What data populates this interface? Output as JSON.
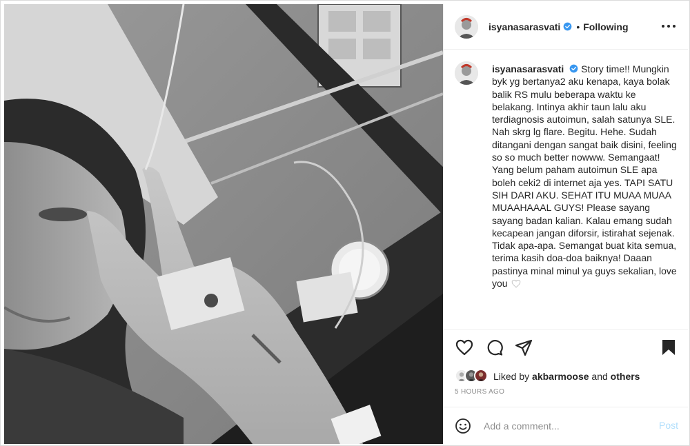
{
  "post": {
    "username": "isyanasarasvati",
    "follow_status": "Following",
    "separator": "•",
    "caption_text": "Story time!! Mungkin byk yg bertanya2 aku kenapa, kaya bolak balik RS mulu beberapa waktu ke belakang. Intinya akhir taun lalu aku terdiagnosis autoimun, salah satunya SLE. Nah skrg lg flare. Begitu. Hehe. Sudah ditangani dengan sangat baik disini, feeling so so much better nowww. Semangaat! Yang belum paham autoimun SLE apa boleh ceki2 di internet aja yes. TAPI SATU SIH DARI AKU. SEHAT ITU MUAA MUAA MUAAHAAAL GUYS! Please sayang sayang badan kalian. Kalau emang sudah kecapean jangan diforsir, istirahat sejenak. Tidak apa-apa. Semangat buat kita semua, terima kasih doa-doa baiknya! Daaan pastinya minal minul ya guys sekalian, love you",
    "likes": {
      "prefix": "Liked by",
      "user": "akbarmoose",
      "joiner": "and",
      "others": "others"
    },
    "timestamp": "5 HOURS AGO"
  },
  "comment": {
    "placeholder": "Add a comment...",
    "post_label": "Post"
  },
  "icons": {
    "verified": "verified-badge-icon",
    "more": "more-options-icon",
    "like": "heart-icon",
    "comment": "comment-icon",
    "share": "share-icon",
    "save": "bookmark-icon",
    "emoji": "emoji-icon"
  },
  "colors": {
    "verified_blue": "#3897f0",
    "post_disabled": "#b2dffc",
    "muted_text": "#8e8e8e",
    "text": "#262626",
    "border": "#efefef"
  }
}
